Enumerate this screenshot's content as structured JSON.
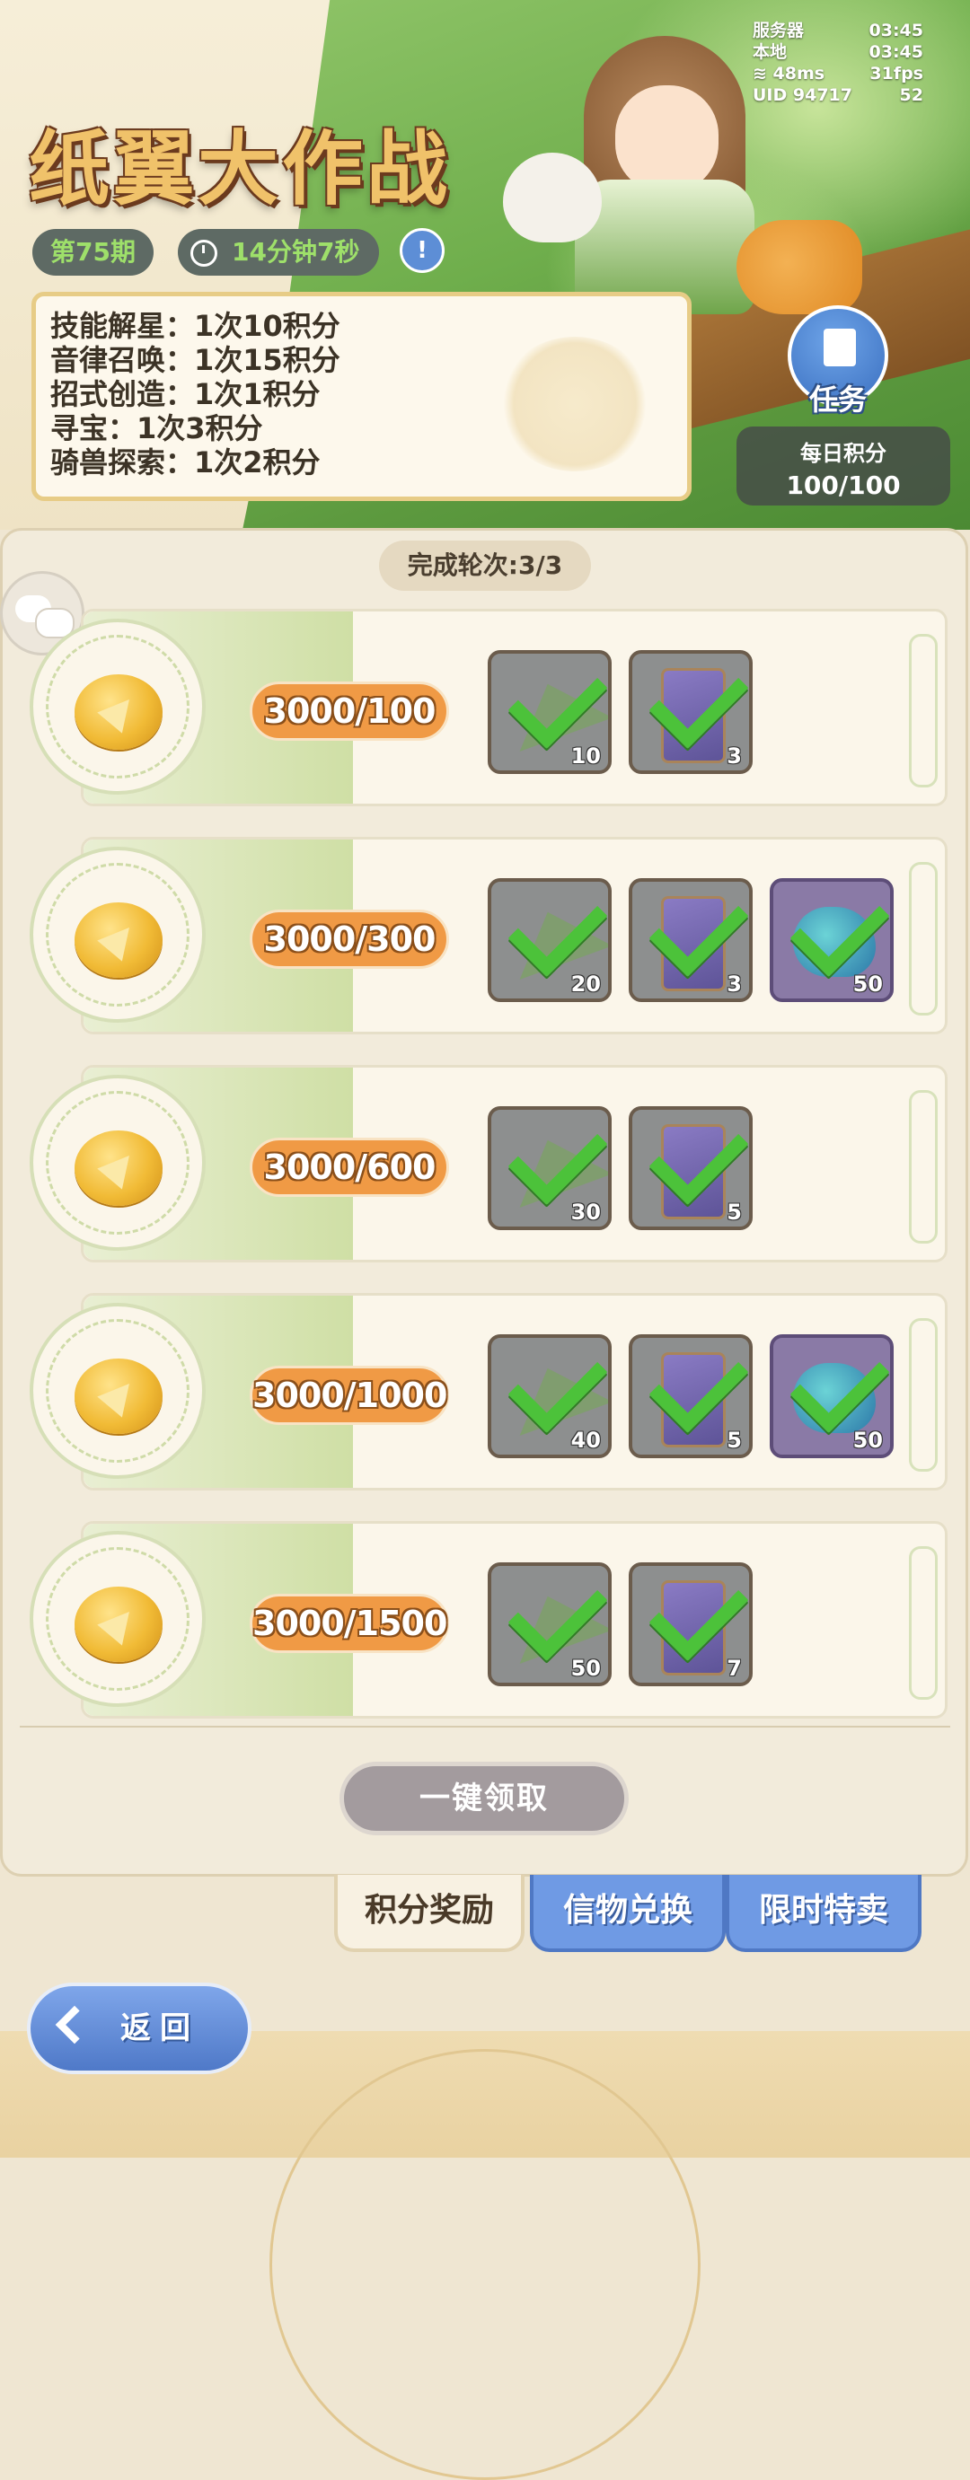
{
  "status": {
    "server_label": "服务器",
    "server_time": "03:45",
    "local_label": "本地",
    "local_time": "03:45",
    "ping": "48ms",
    "fps": "31fps",
    "uid": "UID 94717",
    "battery": "52"
  },
  "header": {
    "title": "纸翼大作战",
    "period": "第75期",
    "timer": "14分钟7秒",
    "info_icon": "!"
  },
  "rules": [
    "技能解星：1次10积分",
    "音律召唤：1次15积分",
    "招式创造：1次1积分",
    "寻宝：1次3积分",
    "骑兽探索：1次2积分"
  ],
  "task": {
    "label": "任务"
  },
  "daily": {
    "label": "每日积分",
    "value": "100/100"
  },
  "rounds": {
    "label": "完成轮次:3/3"
  },
  "rewards": [
    {
      "score": "3000/100",
      "items": [
        {
          "type": "plane",
          "qty": "10"
        },
        {
          "type": "card",
          "qty": "3"
        }
      ]
    },
    {
      "score": "3000/300",
      "items": [
        {
          "type": "plane",
          "qty": "20"
        },
        {
          "type": "card",
          "qty": "3"
        },
        {
          "type": "slime",
          "qty": "50"
        }
      ]
    },
    {
      "score": "3000/600",
      "items": [
        {
          "type": "plane",
          "qty": "30"
        },
        {
          "type": "card",
          "qty": "5"
        }
      ]
    },
    {
      "score": "3000/1000",
      "items": [
        {
          "type": "plane",
          "qty": "40"
        },
        {
          "type": "card",
          "qty": "5"
        },
        {
          "type": "slime",
          "qty": "50"
        }
      ]
    },
    {
      "score": "3000/1500",
      "items": [
        {
          "type": "plane",
          "qty": "50"
        },
        {
          "type": "card",
          "qty": "7"
        }
      ]
    }
  ],
  "claim_all": "一键领取",
  "tabs": [
    "积分奖励",
    "信物兑换",
    "限时特卖"
  ],
  "back": "返回",
  "colors": {
    "accent_orange": "#f09a45",
    "tab_blue": "#6f9ae4",
    "check_green": "#4cc23a"
  }
}
